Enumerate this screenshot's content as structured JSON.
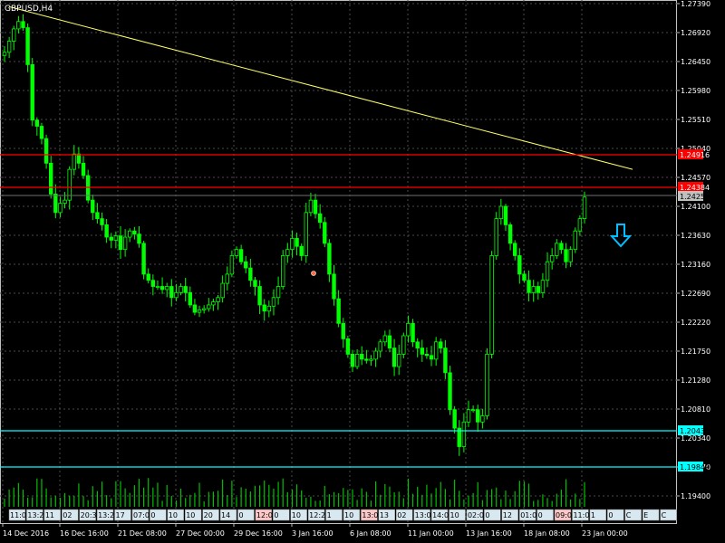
{
  "symbol_title": "GBPUSD,H4",
  "colors": {
    "background": "#000000",
    "candle": "#00ff00",
    "grid": "#5a5a5a",
    "resistance": "#ff0000",
    "support": "#00ffff",
    "trendline": "#ffff66",
    "current_price_marker": "#c0c0c0",
    "arrow": "#00bfff"
  },
  "price_axis": {
    "ticks": [
      "1.27390",
      "1.26920",
      "1.26450",
      "1.25980",
      "1.25510",
      "1.25040",
      "1.24570",
      "1.24100",
      "1.23630",
      "1.23160",
      "1.22690",
      "1.22220",
      "1.21750",
      "1.21280",
      "1.20810",
      "1.20340",
      "1.19870",
      "1.19400"
    ]
  },
  "time_axis": {
    "labels": [
      "14 Dec 2016",
      "16 Dec 16:00",
      "21 Dec 08:00",
      "27 Dec 00:00",
      "29 Dec 16:00",
      "3 Jan 16:00",
      "6 Jan 08:00",
      "11 Jan 00:00",
      "13 Jan 16:00",
      "18 Jan 08:00",
      "23 Jan 00:00"
    ]
  },
  "bottom_strip_tags": [
    "11:02",
    "13:2",
    "11",
    "02",
    "20:30",
    "13:2",
    "17",
    "07:0",
    "0",
    "10",
    "10",
    "20",
    "14",
    "0",
    "12:00",
    "0",
    "10",
    "12:20",
    "1",
    "10",
    "13:01",
    "13",
    "02",
    "13:0",
    "14:0",
    "10",
    "02:0",
    "0",
    "12",
    "01:00",
    "0",
    "09:00",
    "11:0",
    "1",
    "0",
    "C",
    "E",
    "C"
  ],
  "levels": {
    "resistance_1": "1.24916",
    "resistance_2": "1.24384",
    "current_price": "1.24258",
    "support_1": "1.20437",
    "support_2": "1.19849"
  },
  "chart_data": {
    "type": "candlestick",
    "symbol": "GBPUSD",
    "timeframe": "H4",
    "ylim": [
      1.1925,
      1.2742
    ],
    "x": [
      "14 Dec 2016",
      "16 Dec 16:00",
      "21 Dec 08:00",
      "27 Dec 00:00",
      "29 Dec 16:00",
      "3 Jan 16:00",
      "6 Jan 08:00",
      "11 Jan 00:00",
      "13 Jan 16:00",
      "18 Jan 08:00",
      "23 Jan 00:00"
    ],
    "close_path": [
      [
        0,
        1.266
      ],
      [
        1,
        1.2678
      ],
      [
        2,
        1.2698
      ],
      [
        3,
        1.271
      ],
      [
        4,
        1.27
      ],
      [
        5,
        1.264
      ],
      [
        6,
        1.255
      ],
      [
        7,
        1.254
      ],
      [
        8,
        1.252
      ],
      [
        9,
        1.248
      ],
      [
        10,
        1.243
      ],
      [
        11,
        1.24
      ],
      [
        12,
        1.2415
      ],
      [
        13,
        1.242
      ],
      [
        14,
        1.247
      ],
      [
        15,
        1.2495
      ],
      [
        16,
        1.248
      ],
      [
        17,
        1.246
      ],
      [
        18,
        1.242
      ],
      [
        19,
        1.24
      ],
      [
        20,
        1.239
      ],
      [
        21,
        1.238
      ],
      [
        22,
        1.236
      ],
      [
        23,
        1.2355
      ],
      [
        24,
        1.2362
      ],
      [
        25,
        1.234
      ],
      [
        26,
        1.236
      ],
      [
        27,
        1.237
      ],
      [
        28,
        1.2365
      ],
      [
        29,
        1.235
      ],
      [
        30,
        1.23
      ],
      [
        31,
        1.229
      ],
      [
        32,
        1.228
      ],
      [
        33,
        1.228
      ],
      [
        34,
        1.2275
      ],
      [
        35,
        1.228
      ],
      [
        36,
        1.2262
      ],
      [
        37,
        1.227
      ],
      [
        38,
        1.228
      ],
      [
        39,
        1.227
      ],
      [
        40,
        1.225
      ],
      [
        41,
        1.2238
      ],
      [
        42,
        1.2242
      ],
      [
        43,
        1.2244
      ],
      [
        44,
        1.225
      ],
      [
        45,
        1.2255
      ],
      [
        46,
        1.2262
      ],
      [
        47,
        1.2285
      ],
      [
        48,
        1.23
      ],
      [
        49,
        1.233
      ],
      [
        50,
        1.234
      ],
      [
        51,
        1.232
      ],
      [
        52,
        1.231
      ],
      [
        53,
        1.229
      ],
      [
        54,
        1.228
      ],
      [
        55,
        1.225
      ],
      [
        56,
        1.224
      ],
      [
        57,
        1.2248
      ],
      [
        58,
        1.2262
      ],
      [
        59,
        1.228
      ],
      [
        60,
        1.233
      ],
      [
        61,
        1.234
      ],
      [
        62,
        1.2358
      ],
      [
        63,
        1.2345
      ],
      [
        64,
        1.233
      ],
      [
        65,
        1.24
      ],
      [
        66,
        1.242
      ],
      [
        67,
        1.2398
      ],
      [
        68,
        1.2384
      ],
      [
        69,
        1.235
      ],
      [
        70,
        1.23
      ],
      [
        71,
        1.226
      ],
      [
        72,
        1.222
      ],
      [
        73,
        1.2195
      ],
      [
        74,
        1.217
      ],
      [
        75,
        1.215
      ],
      [
        76,
        1.217
      ],
      [
        77,
        1.2162
      ],
      [
        78,
        1.216
      ],
      [
        79,
        1.2162
      ],
      [
        80,
        1.2175
      ],
      [
        81,
        1.219
      ],
      [
        82,
        1.22
      ],
      [
        83,
        1.218
      ],
      [
        84,
        1.215
      ],
      [
        85,
        1.217
      ],
      [
        86,
        1.22
      ],
      [
        87,
        1.222
      ],
      [
        88,
        1.219
      ],
      [
        89,
        1.218
      ],
      [
        90,
        1.217
      ],
      [
        91,
        1.2168
      ],
      [
        92,
        1.2162
      ],
      [
        93,
        1.219
      ],
      [
        94,
        1.218
      ],
      [
        95,
        1.214
      ],
      [
        96,
        1.208
      ],
      [
        97,
        1.205
      ],
      [
        98,
        1.202
      ],
      [
        99,
        1.206
      ],
      [
        100,
        1.208
      ],
      [
        101,
        1.208
      ],
      [
        102,
        1.206
      ],
      [
        103,
        1.207
      ],
      [
        104,
        1.217
      ],
      [
        105,
        1.233
      ],
      [
        106,
        1.239
      ],
      [
        107,
        1.241
      ],
      [
        108,
        1.238
      ],
      [
        109,
        1.235
      ],
      [
        110,
        1.233
      ],
      [
        111,
        1.23
      ],
      [
        112,
        1.229
      ],
      [
        113,
        1.227
      ],
      [
        114,
        1.228
      ],
      [
        115,
        1.227
      ],
      [
        116,
        1.229
      ],
      [
        117,
        1.232
      ],
      [
        118,
        1.233
      ],
      [
        119,
        1.235
      ],
      [
        120,
        1.234
      ],
      [
        121,
        1.232
      ],
      [
        122,
        1.234
      ],
      [
        123,
        1.237
      ],
      [
        124,
        1.239
      ],
      [
        125,
        1.2425
      ]
    ],
    "lines": {
      "resistance": [
        1.24916,
        1.24384
      ],
      "support": [
        1.20437,
        1.19849
      ],
      "current": 1.24258
    },
    "trendline": {
      "from": [
        1,
        1.2734
      ],
      "to": [
        146,
        1.247
      ]
    }
  }
}
